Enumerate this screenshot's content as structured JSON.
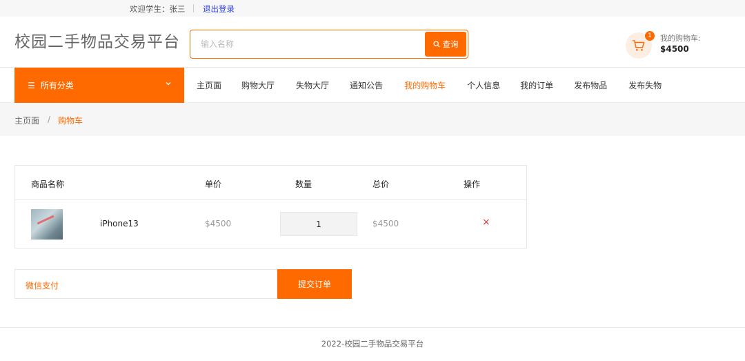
{
  "topbar": {
    "welcome": "欢迎学生：张三",
    "logout": "退出登录"
  },
  "header": {
    "logo": "校园二手物品交易平台",
    "search_placeholder": "输入名称",
    "search_button": "查询",
    "cart_count": "1",
    "cart_label": "我的购物车:",
    "cart_amount": "$4500"
  },
  "nav": {
    "category": "所有分类",
    "links": [
      "主页面",
      "购物大厅",
      "失物大厅",
      "通知公告",
      "我的购物车",
      "个人信息",
      "我的订单",
      "发布物品",
      "发布失物"
    ],
    "active_index": 4
  },
  "breadcrumb": {
    "home": "主页面",
    "separator": "/",
    "current": "购物车"
  },
  "table": {
    "headers": [
      "商品名称",
      "单价",
      "数量",
      "总价",
      "操作"
    ],
    "rows": [
      {
        "name": "iPhone13",
        "price": "$4500",
        "quantity": "1",
        "total": "$4500",
        "remove": "×"
      }
    ]
  },
  "payment": {
    "method": "微信支付",
    "submit": "提交订单"
  },
  "footer": {
    "text": "2022-校园二手物品交易平台"
  },
  "colors": {
    "accent": "#ff6a00",
    "link": "#2b3fd8",
    "danger": "#e4393c"
  },
  "icons": {
    "search": "search-icon",
    "cart": "cart-icon",
    "menu": "menu-icon",
    "chevron": "chevron-down-icon"
  }
}
